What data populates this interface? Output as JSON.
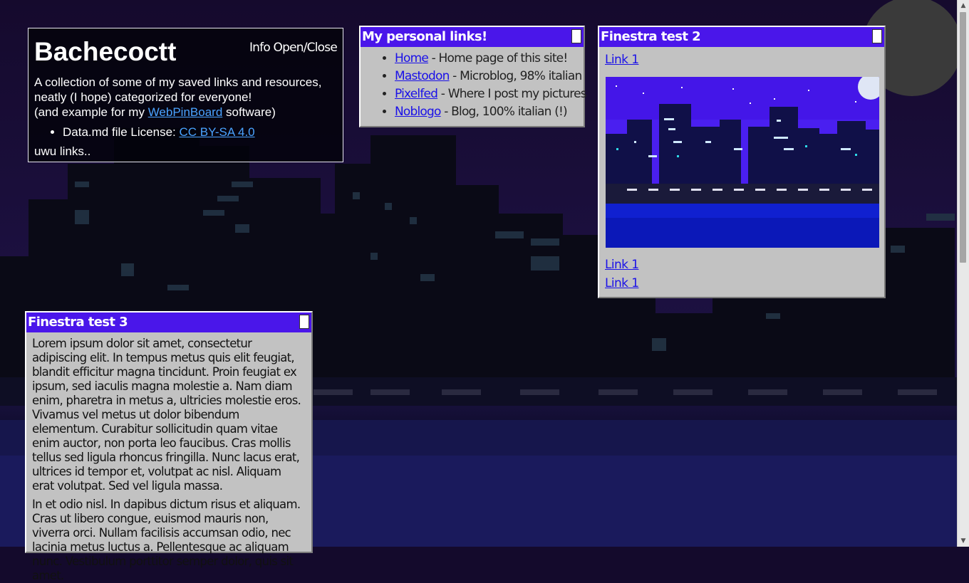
{
  "info": {
    "title": "Bachecoctt",
    "toggle_label": "Info Open/Close",
    "desc_line1": "A collection of some of my saved links and resources, neatly (I hope) categorized for everyone!",
    "desc_prefix": "(and example for my ",
    "desc_link": "WebPinBoard",
    "desc_suffix": " software)",
    "license_prefix": "Data.md file License: ",
    "license_link": "CC BY-SA 4.0",
    "footer": "uwu links.."
  },
  "window_links": {
    "title": "My personal links!",
    "items": [
      {
        "label": "Home",
        "desc": " - Home page of this site!"
      },
      {
        "label": "Mastodon",
        "desc": " - Microblog, 98% italian"
      },
      {
        "label": "Pixelfed",
        "desc": " - Where I post my pictures"
      },
      {
        "label": "Noblogo",
        "desc": " - Blog, 100% italian (!)"
      }
    ]
  },
  "window_test2": {
    "title": "Finestra test 2",
    "link_top": "Link 1",
    "link_bottom_1": "Link 1",
    "link_bottom_2": "Link 1"
  },
  "window_test3": {
    "title": "Finestra test 3",
    "para1": "Lorem ipsum dolor sit amet, consectetur adipiscing elit. In tempus metus quis elit feugiat, blandit efficitur magna tincidunt. Proin feugiat ex ipsum, sed iaculis magna molestie a. Nam diam enim, pharetra in metus a, ultricies molestie eros. Vivamus vel metus ut dolor bibendum elementum. Curabitur sollicitudin quam vitae enim auctor, non porta leo faucibus. Cras mollis tellus sed ligula rhoncus fringilla. Nunc lacus erat, ultrices id tempor et, volutpat ac nisl. Aliquam erat volutpat. Sed vel ligula massa.",
    "para2": "In et odio nisl. In dapibus dictum risus et aliquam. Cras ut libero congue, euismod mauris non, viverra orci. Nullam facilisis accumsan odio, nec lacinia metus luctus a. Pellentesque ac aliquam nunc. Vestibulum porttitor semper dolor, quis sit amet."
  },
  "colors": {
    "titlebar": "#4a16ea",
    "window_bg": "#c2c2c2",
    "link": "#1a10e8",
    "info_link": "#4aa3ff",
    "sky": "#140a2c"
  }
}
